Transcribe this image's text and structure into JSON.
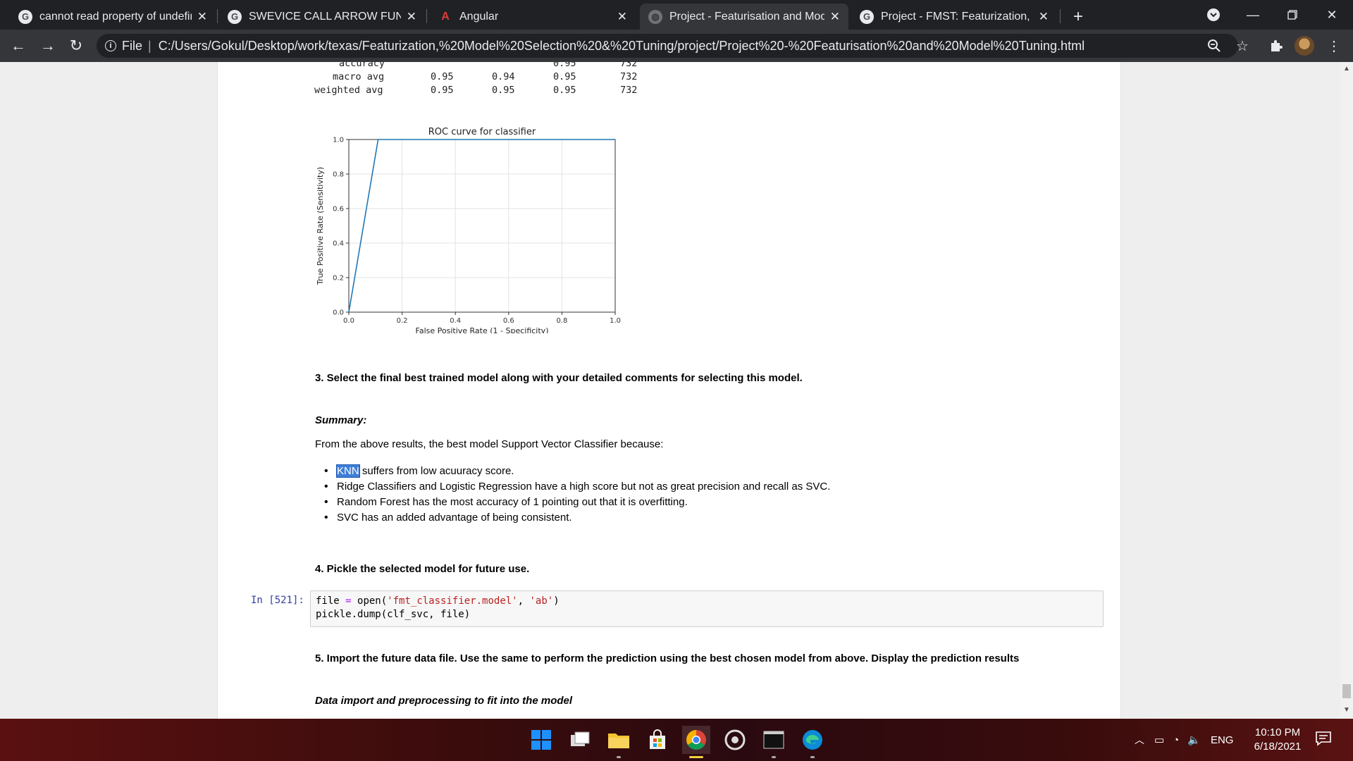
{
  "browser": {
    "tabs": [
      {
        "title": "cannot read property of undefine",
        "favicon": "g-icon",
        "active": false
      },
      {
        "title": "SWEVICE CALL ARROW FUNCTIO",
        "favicon": "g-icon",
        "active": false
      },
      {
        "title": "Angular",
        "favicon": "angular-icon",
        "active": false
      },
      {
        "title": "Project - Featurisation and Mode",
        "favicon": "globe-icon",
        "active": true
      },
      {
        "title": "Project - FMST: Featurization, Mo",
        "favicon": "g-icon",
        "active": false
      }
    ],
    "new_tab_label": "+",
    "address": {
      "scheme_label": "File",
      "separator": "|",
      "url": "C:/Users/Gokul/Desktop/work/texas/Featurization,%20Model%20Selection%20&%20Tuning/project/Project%20-%20Featurisation%20and%20Model%20Tuning.html"
    }
  },
  "report": {
    "rows": [
      {
        "label": "accuracy",
        "c1": "",
        "c2": "",
        "c3": "0.95",
        "c4": "732"
      },
      {
        "label": "macro avg",
        "c1": "0.95",
        "c2": "0.94",
        "c3": "0.95",
        "c4": "732"
      },
      {
        "label": "weighted avg",
        "c1": "0.95",
        "c2": "0.95",
        "c3": "0.95",
        "c4": "732"
      }
    ]
  },
  "chart_data": {
    "type": "line",
    "title": "ROC curve for classifier",
    "xlabel": "False Positive Rate (1 - Specificity)",
    "ylabel": "True Positive Rate (Sensitivity)",
    "xlim": [
      0.0,
      1.0
    ],
    "ylim": [
      0.0,
      1.0
    ],
    "xticks": [
      "0.0",
      "0.2",
      "0.4",
      "0.6",
      "0.8",
      "1.0"
    ],
    "yticks": [
      "0.0",
      "0.2",
      "0.4",
      "0.6",
      "0.8",
      "1.0"
    ],
    "grid": true,
    "series": [
      {
        "x": [
          0.0,
          0.11,
          1.0
        ],
        "y": [
          0.0,
          1.0,
          1.0
        ],
        "color": "#1f77b4"
      }
    ]
  },
  "content": {
    "heading3": "3. Select the final best trained model along with your detailed comments for selecting this model.",
    "summary_label": "Summary:",
    "summary_intro": "From the above results, the best model Support Vector Classifier because:",
    "bullet1_highlight": "KNN",
    "bullet1_rest": " suffers from low acuuracy score.",
    "bullet2": "Ridge Classifiers and Logistic Regression have a high score but not as great precision and recall as SVC.",
    "bullet3": "Random Forest has the most accuracy of 1 pointing out that it is overfitting.",
    "bullet4": "SVC has an added advantage of being consistent.",
    "heading4": "4. Pickle the selected model for future use.",
    "prompt": "In [521]:",
    "code_line1_a": "file ",
    "code_line1_op": "=",
    "code_line1_b": " open(",
    "code_line1_s1": "'fmt_classifier.model'",
    "code_line1_c": ", ",
    "code_line1_s2": "'ab'",
    "code_line1_d": ")",
    "code_line2": "pickle.dump(clf_svc, file)",
    "heading5": "5. Import the future data file. Use the same to perform the prediction using the best chosen model from above. Display the prediction results",
    "subheading": "Data import and preprocessing to fit into the model"
  },
  "taskbar": {
    "time": "10:10 PM",
    "date": "6/18/2021",
    "language": "ENG"
  }
}
